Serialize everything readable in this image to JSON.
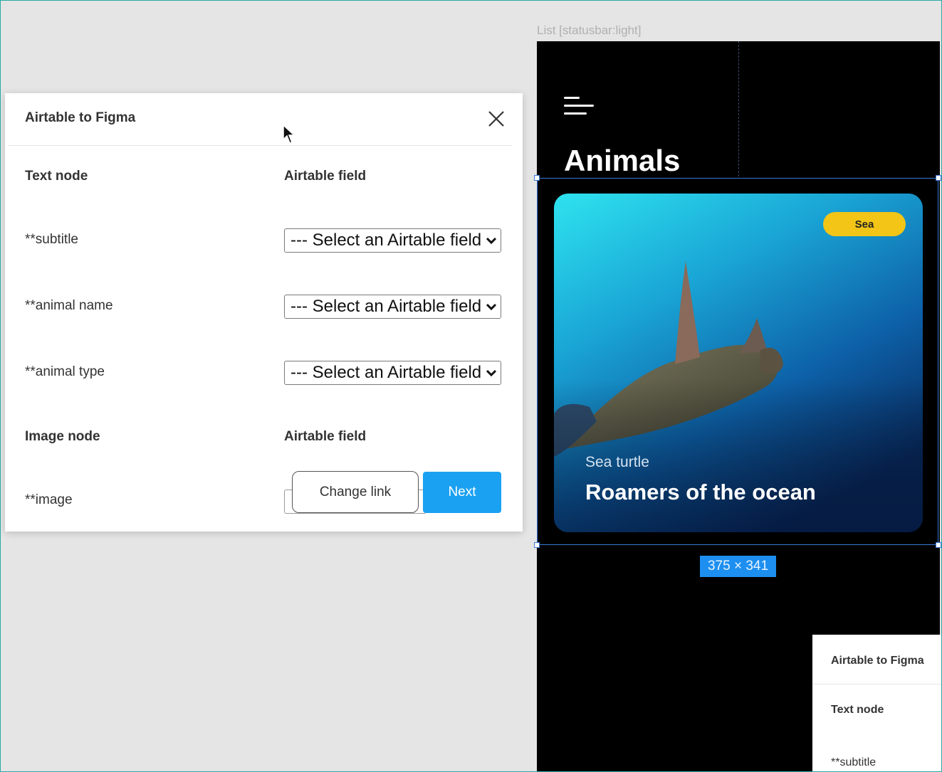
{
  "plugin": {
    "title": "Airtable to Figma",
    "text_section": {
      "node_header": "Text node",
      "field_header": "Airtable field"
    },
    "text_rows": [
      {
        "label": "**subtitle",
        "select_value": "--- Select an Airtable field ---"
      },
      {
        "label": "**animal name",
        "select_value": "--- Select an Airtable field ---"
      },
      {
        "label": "**animal type",
        "select_value": "--- Select an Airtable field ---"
      }
    ],
    "image_section": {
      "node_header": "Image node",
      "field_header": "Airtable field"
    },
    "image_row": {
      "label": "**image"
    },
    "buttons": {
      "change_link": "Change link",
      "next": "Next"
    }
  },
  "canvas": {
    "frame_label": "List [statusbar:light]",
    "screen_title": "Animals",
    "card": {
      "tag": "Sea",
      "subtitle": "Sea turtle",
      "title": "Roamers of the ocean"
    },
    "dimension_badge": "375 × 341"
  },
  "plugin_secondary": {
    "title": "Airtable to Figma",
    "text_node": "Text node",
    "first_row": "**subtitle"
  },
  "colors": {
    "accent_blue": "#1ba1f2",
    "tag_yellow": "#f2c517",
    "selection_blue": "#3b78d6",
    "canvas_bg": "#e5e5e5"
  },
  "icons": [
    "close-icon",
    "chevron-down-icon",
    "hamburger-menu-icon",
    "cursor-arrow-icon"
  ]
}
